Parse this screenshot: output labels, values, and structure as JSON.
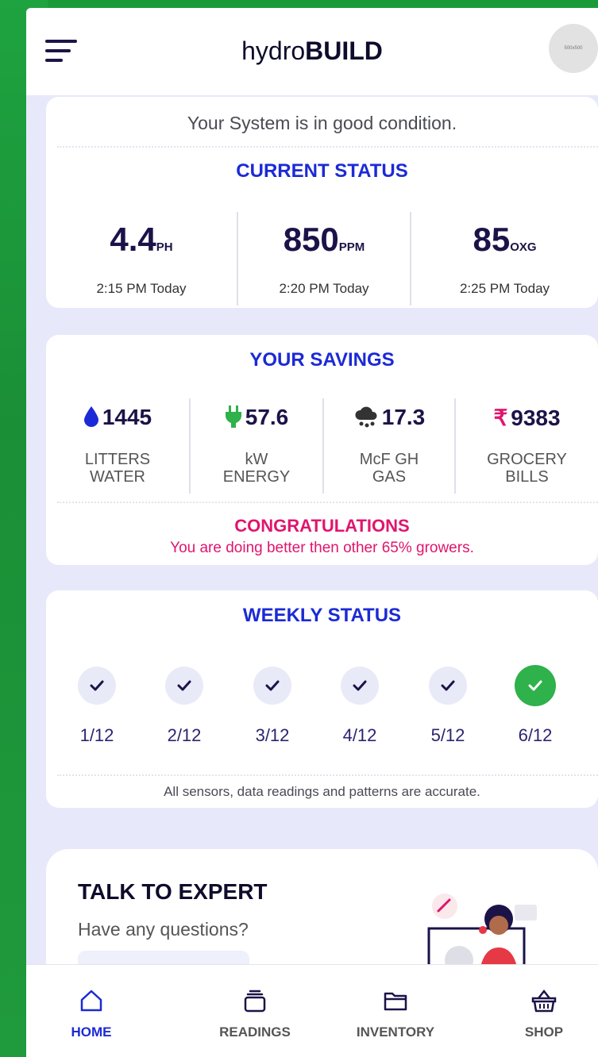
{
  "app": {
    "brand_light": "hydro",
    "brand_bold": "BUILD",
    "avatar_text": "500x500"
  },
  "status_card": {
    "message": "Your System is in good condition.",
    "title": "CURRENT STATUS",
    "stats": [
      {
        "value": "4.4",
        "unit": "PH",
        "time": "2:15 PM Today"
      },
      {
        "value": "850",
        "unit": "PPM",
        "time": "2:20 PM Today"
      },
      {
        "value": "85",
        "unit": "OXG",
        "time": "2:25 PM Today"
      }
    ]
  },
  "savings_card": {
    "title": "YOUR SAVINGS",
    "items": [
      {
        "icon": "water-drop-icon",
        "value": "1445",
        "label1": "LITTERS",
        "label2": "WATER"
      },
      {
        "icon": "plug-icon",
        "value": "57.6",
        "label1": "kW",
        "label2": "ENERGY"
      },
      {
        "icon": "cloud-icon",
        "value": "17.3",
        "label1": "McF GH",
        "label2": "GAS"
      },
      {
        "icon": "rupee-icon",
        "symbol": "₹",
        "value": "9383",
        "label1": "GROCERY",
        "label2": "BILLS"
      }
    ],
    "congrats_title": "CONGRATULATIONS",
    "congrats_text": "You are doing better then other 65% growers."
  },
  "weekly_card": {
    "title": "WEEKLY STATUS",
    "days": [
      "1/12",
      "2/12",
      "3/12",
      "4/12",
      "5/12",
      "6/12"
    ],
    "footer": "All sensors, data readings and patterns are accurate."
  },
  "expert_card": {
    "title": "TALK TO EXPERT",
    "subtitle": "Have any questions?"
  },
  "nav": {
    "items": [
      "HOME",
      "READINGS",
      "INVENTORY",
      "SHOP"
    ],
    "active": "HOME"
  },
  "colors": {
    "accent": "#1b2ad6",
    "success": "#2fb14b",
    "pink": "#e0156e",
    "dark": "#1b1348",
    "bg": "#e7e9fb"
  }
}
